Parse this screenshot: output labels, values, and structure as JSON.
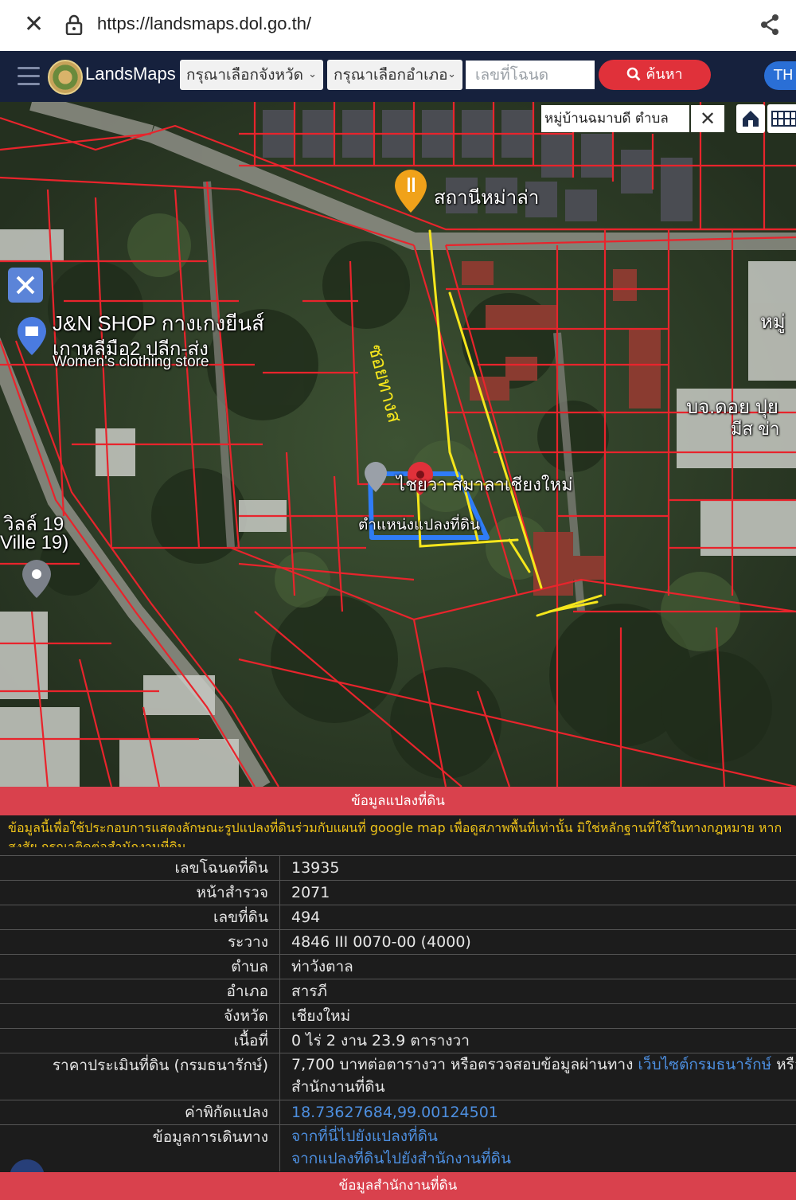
{
  "browser": {
    "url": "https://landsmaps.dol.go.th/"
  },
  "navbar": {
    "brand": "LandsMaps",
    "province_select": "กรุณาเลือกจังหวัด",
    "district_select": "กรุณาเลือกอำเภอ",
    "deed_placeholder": "เลขที่โฉนด",
    "search_label": "ค้นหา",
    "lang_label": "TH"
  },
  "map": {
    "search_chip": "หมู่บ้านฉมาบดี ตำบล",
    "labels": {
      "station": "สถานีหม่าล่า",
      "shop_1": "J&N SHOP กางเกงยีนส์",
      "shop_2": "เกาหลีมือ2 ปลีก-ส่ง",
      "shop_3": "Women's clothing store",
      "ville_1": "วิลล์ 19",
      "ville_2": "Ville 19)",
      "parcel_road": "ไชยวา สมาลาเชียงใหม่",
      "parcel_position": "ตำแหน่งแปลงที่ดิน",
      "east_1": "บจ.ดอย ปุย",
      "east_2": "มีส ข่า",
      "east_top": "หมู่",
      "handwriting": "ซอยทางส"
    },
    "colors": {
      "parcel_line": "#e8242c",
      "highlight": "#2f7cf6",
      "annotation": "#f5e61c"
    }
  },
  "panel": {
    "title": "ข้อมูลแปลงที่ดิน",
    "notice": "ข้อมูลนี้เพื่อใช้ประกอบการแสดงลักษณะรูปแปลงที่ดินร่วมกับแผนที่ google map เพื่อดูสภาพพื้นที่เท่านั้น มิใช่หลักฐานที่ใช้ในทางกฎหมาย หากสงสัย กรุณาติดต่อสำนักงานที่ดิน",
    "rows": {
      "deed_label": "เลขโฉนดที่ดิน",
      "deed": "13935",
      "survey_label": "หน้าสำรวจ",
      "survey": "2071",
      "land_no_label": "เลขที่ดิน",
      "land_no": "494",
      "sheet_label": "ระวาง",
      "sheet": "4846 III 0070-00 (4000)",
      "subdistrict_label": "ตำบล",
      "subdistrict": "ท่าวังตาล",
      "district_label": "อำเภอ",
      "district": "สารภี",
      "province_label": "จังหวัด",
      "province": "เชียงใหม่",
      "area_label": "เนื้อที่",
      "area": "0 ไร่ 2 งาน 23.9 ตารางวา",
      "price_label": "ราคาประเมินที่ดิน (กรมธนารักษ์)",
      "price_text": "7,700 บาทต่อตารางวา หรือตรวจสอบข้อมูลผ่านทาง ",
      "price_link": "เว็บไซต์กรมธนารักษ์",
      "price_tail": " หรือ",
      "price_line2": "สำนักงานที่ดิน",
      "coord_label": "ค่าพิกัดแปลง",
      "coord": "18.73627684,99.00124501",
      "travel_label": "ข้อมูลการเดินทาง",
      "travel_1": "จากที่นี่ไปยังแปลงที่ดิน",
      "travel_2": "จากแปลงที่ดินไปยังสำนักงานที่ดิน"
    },
    "footer": "ข้อมูลสำนักงานที่ดิน"
  }
}
